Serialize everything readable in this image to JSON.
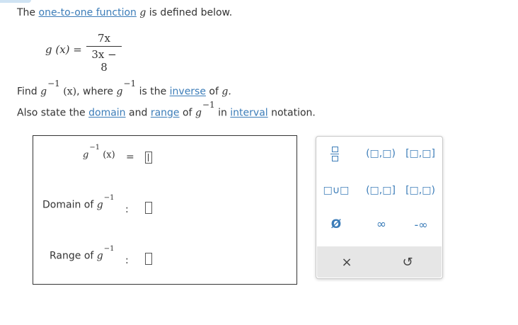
{
  "intro": {
    "prefix": "The ",
    "link": "one-to-one function",
    "var": "g",
    "suffix": " is defined below."
  },
  "function": {
    "lhs": "g (x) =",
    "numerator": "7x",
    "denominator": "3x − 8"
  },
  "find": {
    "p1": "Find ",
    "g": "g",
    "inv": "−1",
    "arg": "(x)",
    "p2": ", where ",
    "p3": " is the ",
    "link_inverse": "inverse",
    "p4": " of ",
    "p5": "g."
  },
  "also": {
    "p1": "Also state the ",
    "link_domain": "domain",
    "p2": " and ",
    "link_range": "range",
    "p3": " of ",
    "p4": " in ",
    "link_interval": "interval",
    "p5": " notation."
  },
  "answer": {
    "ginv_label": "g",
    "ginv_sup": "−1",
    "ginv_arg": "(x)",
    "equals": "=",
    "domain_label": "Domain of ",
    "range_label": "Range of ",
    "colon": ":"
  },
  "palette": {
    "open_open": "(□,□)",
    "closed_closed": "[□,□]",
    "union": "□∪□",
    "open_closed": "(□,□]",
    "closed_open": "[□,□)",
    "empty_set": "Ø",
    "infinity": "∞",
    "neg_infinity": "-∞",
    "clear": "×",
    "undo": "↺",
    "accent_color": "#3b7cb8"
  }
}
